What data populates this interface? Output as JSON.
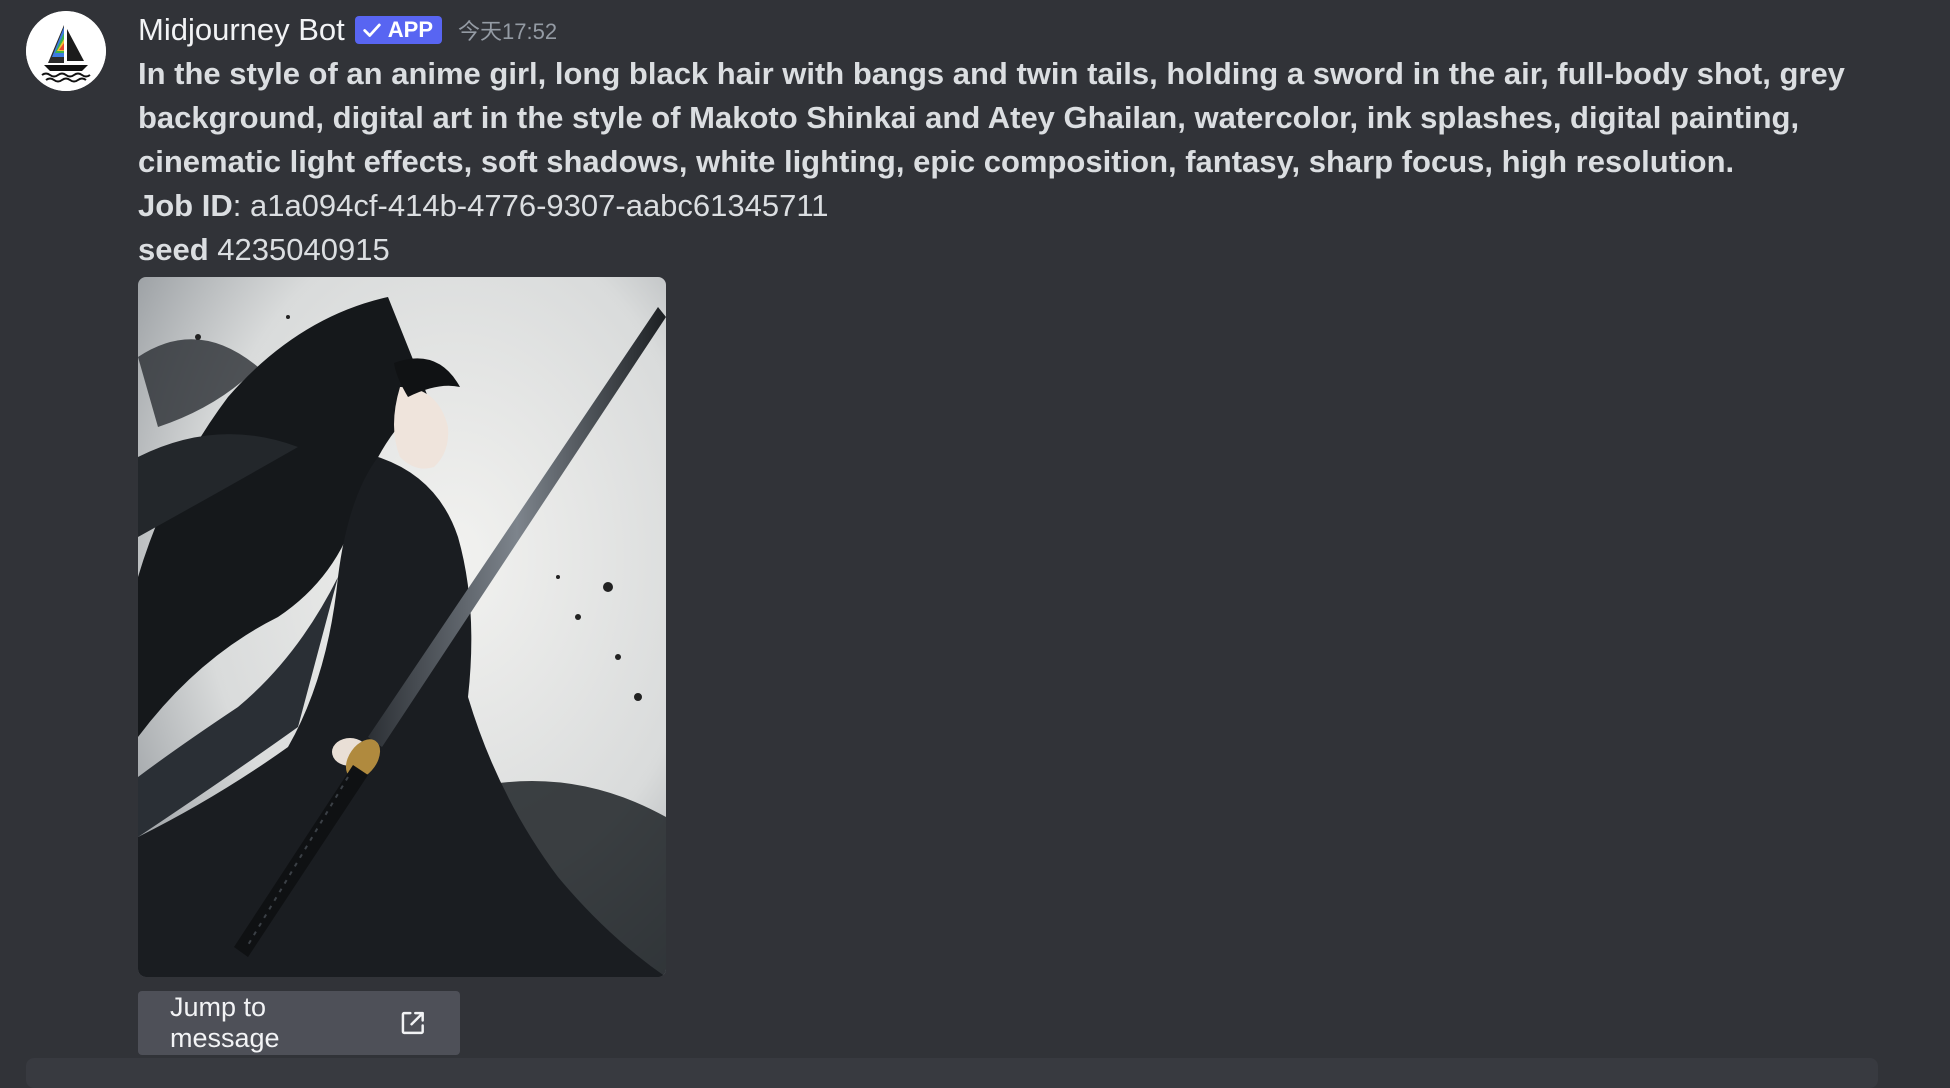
{
  "message": {
    "author": "Midjourney Bot",
    "badge": "APP",
    "timestamp": "今天17:52",
    "prompt": "In the style of an anime girl, long black hair with bangs and twin tails, holding a sword in the air, full-body shot, grey background, digital art in the style of Makoto Shinkai and Atey Ghailan, watercolor, ink splashes, digital painting, cinematic light effects, soft shadows, white lighting, epic composition, fantasy, sharp focus, high resolution.",
    "job_id_label": "Job ID",
    "job_id_value": ": a1a094cf-414b-4776-9307-aabc61345711",
    "seed_label": "seed",
    "seed_value": " 4235040915",
    "jump_label": "Jump to message"
  },
  "icons": {
    "avatar": "midjourney-sailboat-logo",
    "badge_check": "check-icon",
    "jump": "external-link-icon"
  },
  "colors": {
    "background": "#313338",
    "badge": "#5865f2",
    "button": "#4e5058",
    "timestamp": "#949ba4"
  }
}
